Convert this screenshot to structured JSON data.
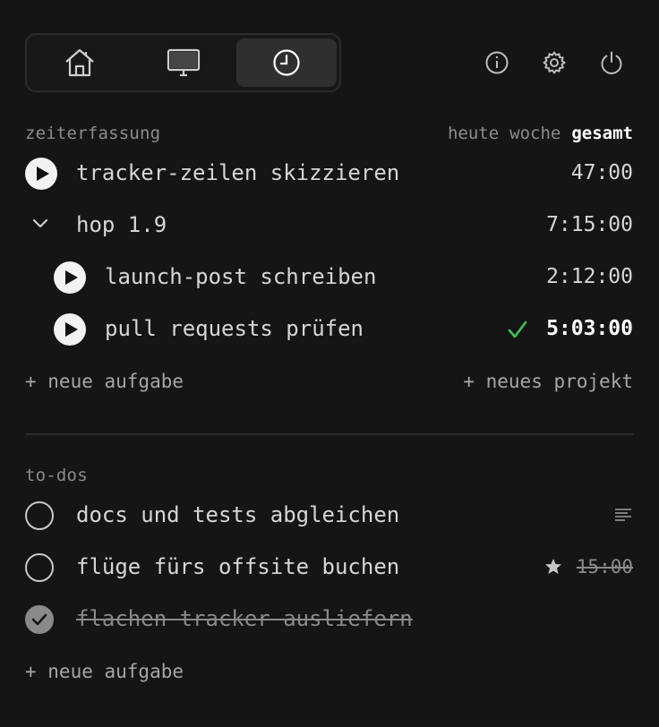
{
  "nav": {
    "tabs": [
      {
        "name": "home",
        "active": false
      },
      {
        "name": "display",
        "active": false
      },
      {
        "name": "clock",
        "active": true
      }
    ],
    "actions": [
      "info",
      "settings",
      "power"
    ]
  },
  "tracking": {
    "label": "zeiterfassung",
    "ranges": [
      "heute",
      "woche",
      "gesamt"
    ],
    "active_range": "gesamt",
    "rows": [
      {
        "title": "tracker-zeilen skizzieren",
        "time": "47:00"
      },
      {
        "title": "hop 1.9",
        "time": "7:15:00",
        "expanded": true
      },
      {
        "title": "launch-post schreiben",
        "time": "2:12:00"
      },
      {
        "title": "pull requests prüfen",
        "time": "5:03:00",
        "done": true
      }
    ],
    "new_task": "+ neue aufgabe",
    "new_project": "+ neues projekt"
  },
  "todos": {
    "label": "to-dos",
    "items": [
      {
        "title": "docs und tests abgleichen",
        "done": false
      },
      {
        "title": "flüge fürs offsite buchen",
        "done": false,
        "due": "15:00"
      },
      {
        "title": "flachen tracker ausliefern",
        "done": true
      }
    ],
    "new_task": "+ neue aufgabe"
  },
  "colors": {
    "background": "#151515",
    "accent_green": "#3fc35b",
    "active_tab": "#2f2f2f"
  }
}
